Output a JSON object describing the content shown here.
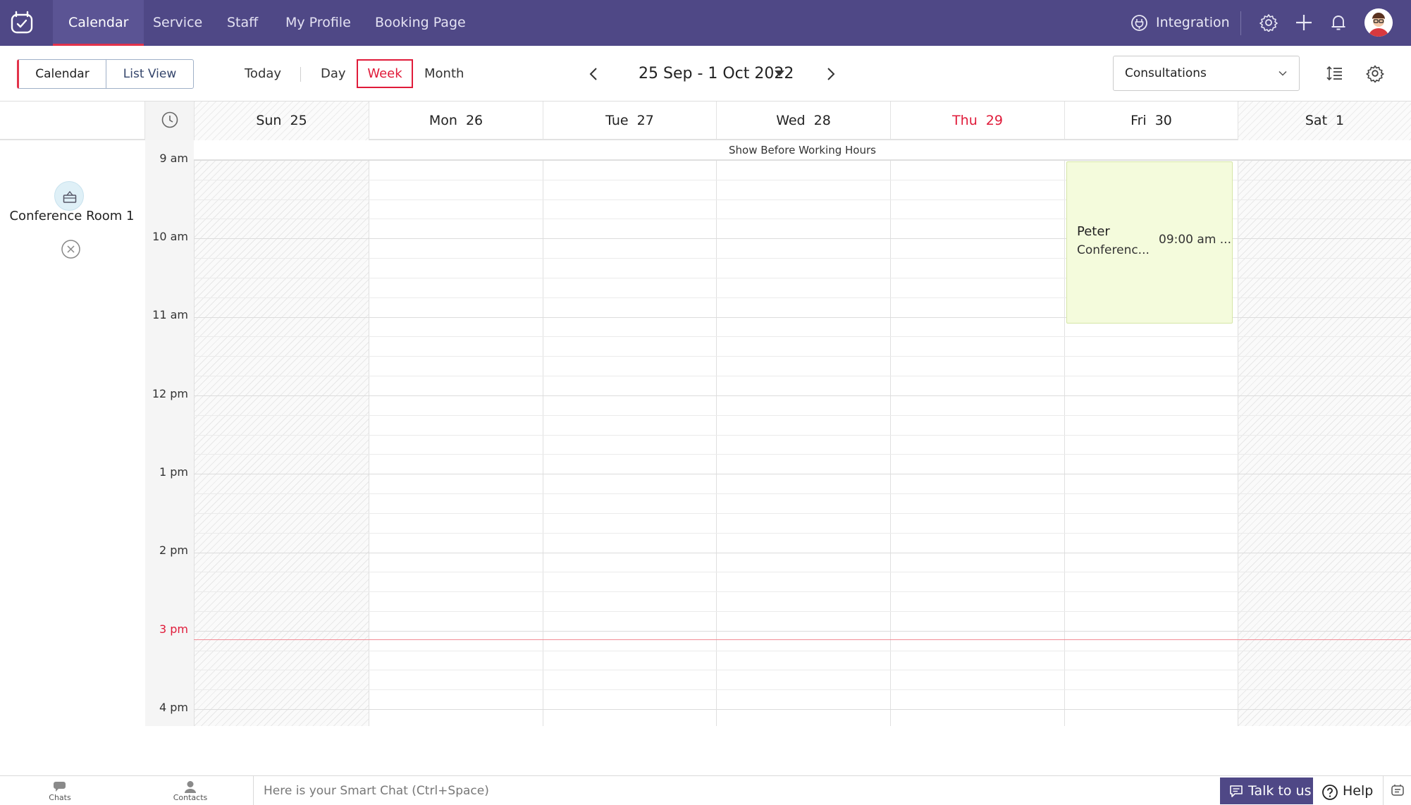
{
  "nav": {
    "tabs": [
      {
        "label": "Calendar",
        "active": true
      },
      {
        "label": "Service"
      },
      {
        "label": "Staff"
      },
      {
        "label": "My Profile"
      },
      {
        "label": "Booking Page"
      }
    ],
    "integration_label": "Integration",
    "icons": [
      "app-logo-icon",
      "integration-icon",
      "settings-icon",
      "add-icon",
      "bell-icon",
      "avatar"
    ],
    "accent_color": "#4f4886"
  },
  "toolbar": {
    "calendar_label": "Calendar",
    "list_view_label": "List View",
    "today_label": "Today",
    "day_label": "Day",
    "week_label": "Week",
    "month_label": "Month",
    "date_range": "25 Sep - 1 Oct 2022",
    "selected_view": "Week",
    "filter_value": "Consultations"
  },
  "week": {
    "days": [
      {
        "name": "Sun",
        "num": "25",
        "off": true
      },
      {
        "name": "Mon",
        "num": "26"
      },
      {
        "name": "Tue",
        "num": "27"
      },
      {
        "name": "Wed",
        "num": "28"
      },
      {
        "name": "Thu",
        "num": "29",
        "today": true
      },
      {
        "name": "Fri",
        "num": "30"
      },
      {
        "name": "Sat",
        "num": "1",
        "off": true
      }
    ],
    "times": [
      "9 am",
      "10 am",
      "11 am",
      "12 pm",
      "1 pm",
      "2 pm",
      "3 pm",
      "4 pm"
    ],
    "current_time_label": "3 pm",
    "show_before_label": "Show Before Working Hours",
    "today_color": "#e01b3a"
  },
  "resource": {
    "name": "Conference Room 1"
  },
  "appointment": {
    "name": "Peter",
    "service": "Conferenc...",
    "time": "09:00 am ...",
    "day": "Fri",
    "color": "#f4fbdc"
  },
  "bottombar": {
    "chats_label": "Chats",
    "contacts_label": "Contacts",
    "smart_chat_placeholder": "Here is your Smart Chat (Ctrl+Space)",
    "talk_label": "Talk to us",
    "help_label": "Help"
  }
}
